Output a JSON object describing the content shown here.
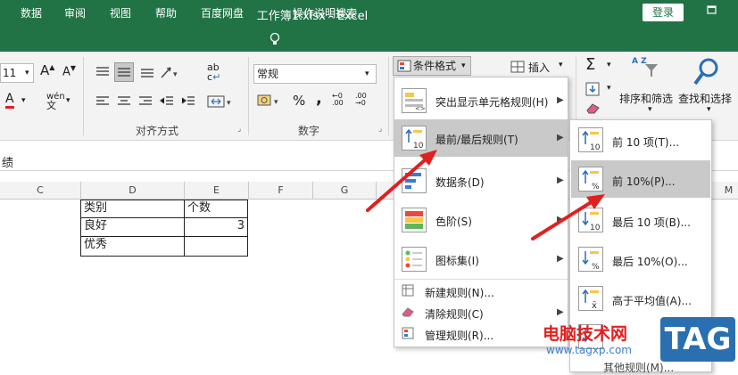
{
  "title": "工作簿1.xlsx  -  Excel",
  "login": "登录",
  "tabs": [
    "数据",
    "审阅",
    "视图",
    "帮助",
    "百度网盘",
    "操作说明搜索"
  ],
  "font_size": "11",
  "number_format": "常规",
  "groups": {
    "align": "对齐方式",
    "number": "数字"
  },
  "glyphs": {
    "wen": "wén",
    "bold_a": "A",
    "pct": "%",
    "comma": ",",
    "ab": "ab",
    "c": "c",
    "sum": "Σ",
    "za": "A Z"
  },
  "buttons": {
    "cond_format": "条件格式",
    "insert": "插入",
    "sort_filter": "排序和筛选",
    "find_select": "查找和选择"
  },
  "formula_bar": "绩",
  "columns": [
    "C",
    "D",
    "E",
    "F",
    "G",
    "M"
  ],
  "cells": {
    "d1": "类别",
    "e1": "个数",
    "d2": "良好",
    "e2": "3",
    "d3": "优秀"
  },
  "menu": {
    "items": [
      "突出显示单元格规则(H)",
      "最前/最后规则(T)",
      "数据条(D)",
      "色阶(S)",
      "图标集(I)"
    ],
    "simple": [
      "新建规则(N)...",
      "清除规则(C)",
      "管理规则(R)..."
    ]
  },
  "submenu": {
    "items": [
      "前 10 项(T)...",
      "前 10%(P)...",
      "最后 10 项(B)...",
      "最后 10%(O)...",
      "高于平均值(A)..."
    ],
    "more": "其他规则(M)..."
  },
  "icon_labels": {
    "top10": "10",
    "pct": "%",
    "avg": "x̄"
  },
  "watermark": {
    "line1": "电脑技术网",
    "line2": "www.tagxp.com",
    "tag": "TAG"
  },
  "accent": "#217346",
  "highlight": "#c9c9c9",
  "arrow": "#e02020"
}
